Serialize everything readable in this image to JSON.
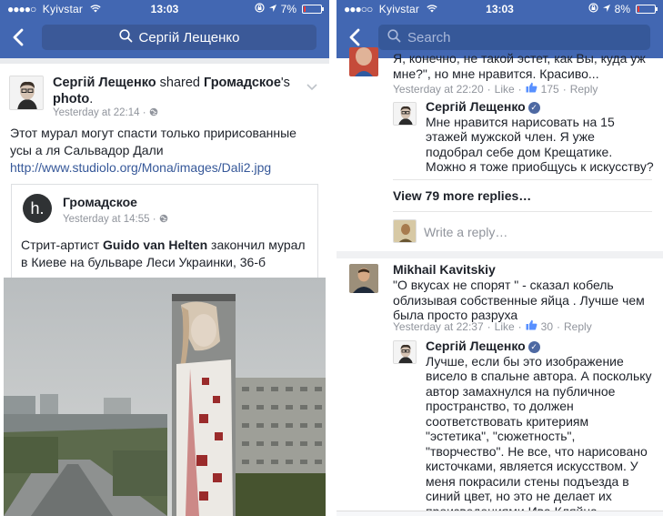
{
  "left": {
    "status": {
      "carrier": "Kyivstar",
      "time": "13:03",
      "battery": "7%",
      "battery_level": 0.07
    },
    "search_label": "Сергій Лещенко",
    "post": {
      "author": "Сергій Лещенко",
      "action": "shared",
      "source": "Громадское",
      "suffix": "'s",
      "object": "photo",
      "period": ".",
      "time": "Yesterday at 22:14",
      "text": "Этот мурал могут спасти только пририсованные усы а ля Сальвадор Дали ",
      "link": "http://www.studiolo.org/Mona/images/Dali2.jpg",
      "shared": {
        "avatar_letter": "h.",
        "name": "Громадское",
        "time": "Yesterday at 14:55",
        "text_before": "Стрит-артист ",
        "text_bold": "Guido van Helten",
        "text_after": " закончил мурал в Киеве на бульваре Леси Украинки, 36-б"
      }
    }
  },
  "right": {
    "status": {
      "carrier": "Kyivstar",
      "time": "13:03",
      "battery": "8%",
      "battery_level": 0.08
    },
    "search_placeholder": "Search",
    "comments": [
      {
        "text": "Я, конечно, не такой эстет, как Вы, куда уж мне?\", но мне нравится. Красиво...",
        "time": "Yesterday at 22:20",
        "like": "Like",
        "likes": "175",
        "reply": "Reply",
        "sep": "·"
      },
      {
        "author": "Сергій Лещенко",
        "text": "Мне нравится нарисовать на 15 этажей мужской член. Я уже подобрал себе дом Крещатике. Можно я тоже приобщусь к искусству?"
      }
    ],
    "view_more": "View 79 more replies…",
    "write_reply": "Write a reply…",
    "comment2": {
      "author": "Mikhail Kavitskiy",
      "text": "\"О вкусах не спорят \" - сказал кобель облизывая собственные яйца .  Лучше чем была просто разруха",
      "time": "Yesterday at 22:37",
      "like": "Like",
      "likes": "30",
      "reply": "Reply",
      "sep": "·"
    },
    "reply2": {
      "author": "Сергій Лещенко",
      "text": "Лучше, если бы это изображение висело в спальне автора. А поскольку автор замахнулся на публичное пространство, то должен соответствовать критериям \"эстетика\", \"сюжетность\", \"творчество\". Не все, что нарисовано кисточками, является искусством. У меня покрасили стены подъезда в синий цвет, но это не делает их произведениями Ива Кляйна"
    }
  },
  "colors": {
    "brand": "#4267b2",
    "link": "#365899",
    "meta": "#90949c",
    "text": "#1d2129"
  }
}
